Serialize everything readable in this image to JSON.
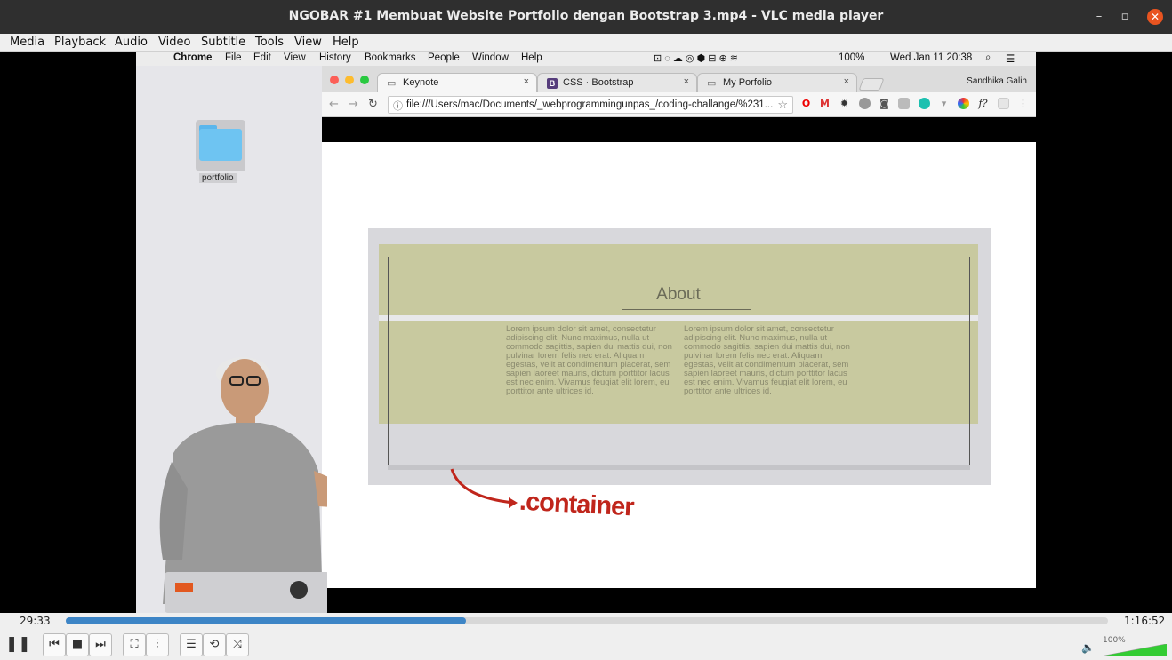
{
  "window": {
    "title": "NGOBAR #1 Membuat Website Portfolio dengan Bootstrap 3.mp4 - VLC media player"
  },
  "menu": [
    "Media",
    "Playback",
    "Audio",
    "Video",
    "Subtitle",
    "Tools",
    "View",
    "Help"
  ],
  "mac_menubar": {
    "app": "Chrome",
    "items": [
      "File",
      "Edit",
      "View",
      "History",
      "Bookmarks",
      "People",
      "Window",
      "Help"
    ],
    "battery": "100%",
    "clock": "Wed Jan 11  20:38"
  },
  "desktop": {
    "folder_label": "portfolio"
  },
  "chrome": {
    "tabs": [
      {
        "label": "Keynote",
        "icon": "page-icon"
      },
      {
        "label": "CSS · Bootstrap",
        "icon": "bootstrap-icon"
      },
      {
        "label": "My Porfolio",
        "icon": "page-icon"
      }
    ],
    "profile": "Sandhika Galih",
    "url": "file:///Users/mac/Documents/_webprogrammingunpas_/coding-challange/%231..."
  },
  "slide": {
    "heading": "About",
    "lorem_left": "Lorem ipsum dolor sit amet, consectetur adipiscing elit. Nunc maximus, nulla ut commodo sagittis, sapien dui mattis dui, non pulvinar lorem felis nec erat. Aliquam egestas, velit at condimentum placerat, sem sapien laoreet mauris, dictum porttitor lacus est nec enim. Vivamus feugiat elit lorem, eu porttitor ante ultrices id.",
    "lorem_right": "Lorem ipsum dolor sit amet, consectetur adipiscing elit. Nunc maximus, nulla ut commodo sagittis, sapien dui mattis dui, non pulvinar lorem felis nec erat. Aliquam egestas, velit at condimentum placerat, sem sapien laoreet mauris, dictum porttitor lacus est nec enim. Vivamus feugiat elit lorem, eu porttitor ante ultrices id.",
    "annotation": ".container"
  },
  "player": {
    "elapsed": "29:33",
    "total": "1:16:52",
    "progress": 0.384,
    "volume": "100%",
    "volume_level": 1.0,
    "accent": "#3d85c6"
  }
}
